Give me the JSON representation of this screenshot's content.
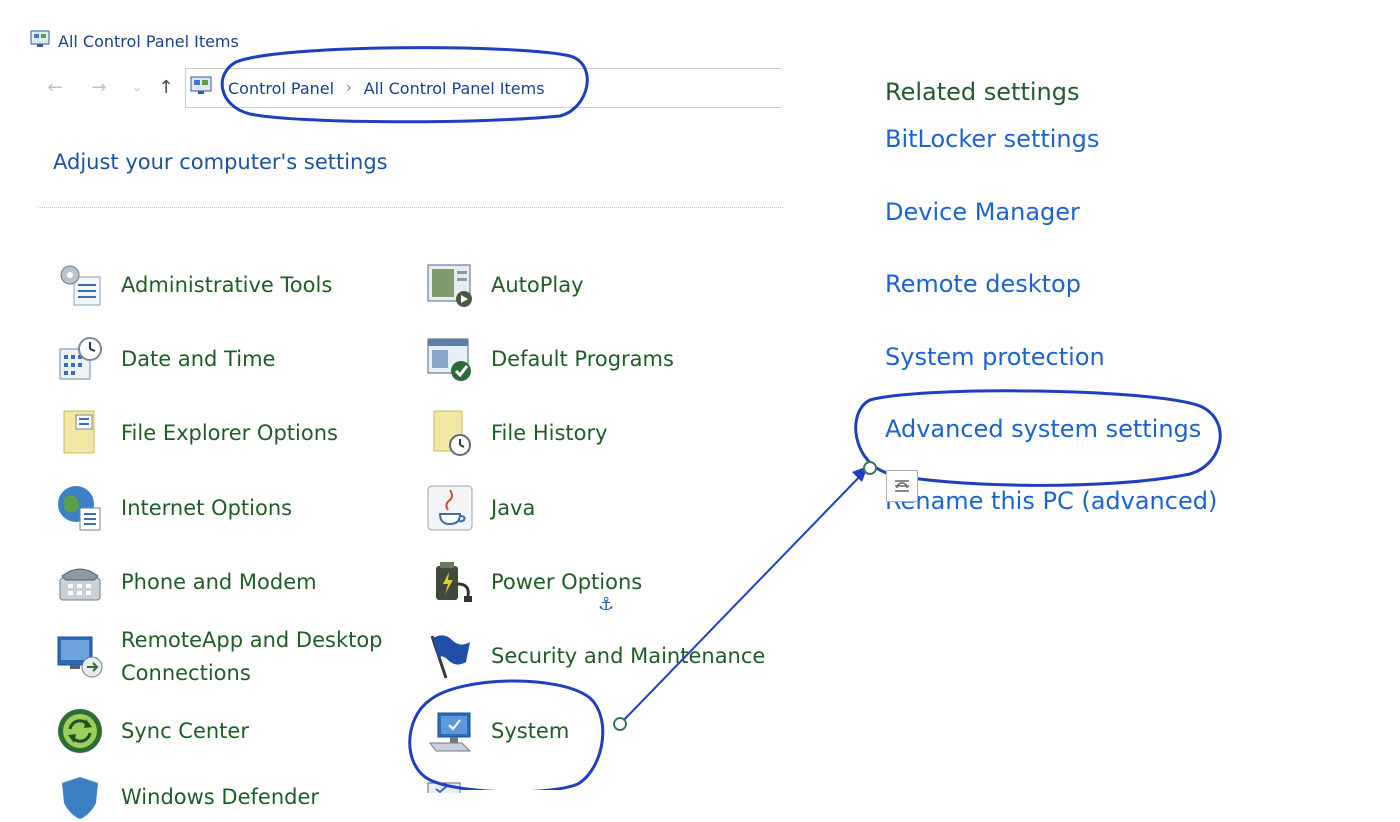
{
  "window": {
    "title": "All Control Panel Items",
    "icon": "control-panel-icon"
  },
  "nav": {
    "back_icon": "arrow-left-icon",
    "forward_icon": "arrow-right-icon",
    "recent_icon": "chevron-down-icon",
    "up_icon": "arrow-up-icon",
    "address_icon": "control-panel-icon",
    "breadcrumbs": [
      "Control Panel",
      "All Control Panel Items"
    ]
  },
  "main": {
    "heading": "Adjust your computer's settings",
    "items": [
      {
        "label": "Administrative Tools",
        "icon": "administrative-tools-icon"
      },
      {
        "label": "AutoPlay",
        "icon": "autoplay-icon"
      },
      {
        "label": "Date and Time",
        "icon": "date-time-icon"
      },
      {
        "label": "Default Programs",
        "icon": "default-programs-icon"
      },
      {
        "label": "File Explorer Options",
        "icon": "file-explorer-options-icon"
      },
      {
        "label": "File History",
        "icon": "file-history-icon"
      },
      {
        "label": "Internet Options",
        "icon": "internet-options-icon"
      },
      {
        "label": "Java",
        "icon": "java-icon"
      },
      {
        "label": "Phone and Modem",
        "icon": "phone-modem-icon"
      },
      {
        "label": "Power Options",
        "icon": "power-options-icon"
      },
      {
        "label": "RemoteApp and Desktop Connections",
        "icon": "remoteapp-icon"
      },
      {
        "label": "Security and Maintenance",
        "icon": "security-maintenance-flag-icon"
      },
      {
        "label": "Sync Center",
        "icon": "sync-center-icon"
      },
      {
        "label": "System",
        "icon": "system-monitor-icon"
      },
      {
        "label": "Windows Defender",
        "icon": "windows-defender-icon"
      }
    ]
  },
  "related": {
    "heading": "Related settings",
    "links": [
      "BitLocker settings",
      "Device Manager",
      "Remote desktop",
      "System protection",
      "Advanced system settings",
      "Rename this PC (advanced)"
    ]
  },
  "annotations": {
    "color": "#1f3fbf",
    "pin_icon": "pin-icon",
    "anchor_icon": "anchor-icon"
  }
}
